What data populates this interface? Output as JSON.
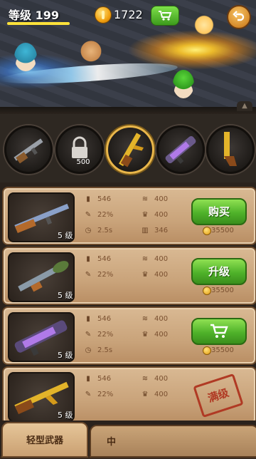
{
  "hud": {
    "level_label": "等级 199",
    "coins": "1722"
  },
  "weapon_slots": [
    {
      "name": "rifle",
      "selected": false,
      "locked": false
    },
    {
      "name": "rocket-launcher",
      "selected": false,
      "locked": true,
      "lock_price": "500"
    },
    {
      "name": "golden-ak",
      "selected": true,
      "locked": false
    },
    {
      "name": "plasma-gun",
      "selected": false,
      "locked": false
    },
    {
      "name": "golden-pistol",
      "selected": false,
      "locked": false
    }
  ],
  "weapons": [
    {
      "level": "5 级",
      "ammo": "546",
      "crit": "22%",
      "reload": "2.5s",
      "damage": "400",
      "range": "400",
      "mag": "346",
      "action": "购买",
      "price": "35500"
    },
    {
      "level": "5 级",
      "ammo": "546",
      "crit": "22%",
      "damage": "400",
      "range": "400",
      "action": "升级",
      "price": "35500"
    },
    {
      "level": "5 级",
      "ammo": "546",
      "crit": "22%",
      "reload": "2.5s",
      "damage": "400",
      "range": "400",
      "action_icon": "cart-icon",
      "price": "35500"
    },
    {
      "level": "5 级",
      "ammo": "546",
      "crit": "22%",
      "damage": "400",
      "range": "400",
      "status": "满级"
    }
  ],
  "tabs": {
    "active": "轻型武器",
    "next": "中"
  },
  "colors": {
    "accent_green": "#4fb22a",
    "level_bar": "#ffe23a"
  }
}
